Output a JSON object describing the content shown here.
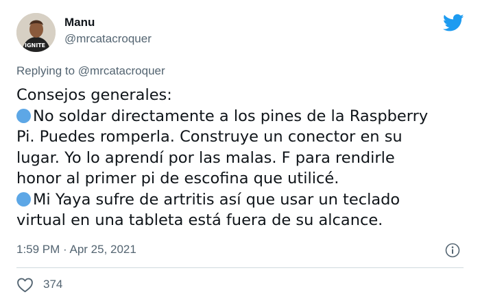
{
  "author": {
    "name": "Manu",
    "handle": "@mrcatacroquer",
    "avatar_text": "IGNITE"
  },
  "reply": {
    "prefix": "Replying to ",
    "to": "@mrcatacroquer"
  },
  "tweet": {
    "lines": [
      "Consejos generales:",
      "No soldar directamente a los pines de la Raspberry",
      "Pi. Puedes romperla. Construye un conector en su",
      "lugar. Yo lo aprendí por las malas. F para rendirle",
      "honor al primer pi de escofina que utilicé.",
      "Mi Yaya sufre de artritis así que usar un teclado",
      "virtual en una tableta está fuera de su alcance."
    ]
  },
  "meta": {
    "timestamp": "1:59 PM · Apr 25, 2021"
  },
  "engagement": {
    "likes": "374"
  },
  "icons": {
    "logo": "twitter-bird-icon",
    "bullet": "blue-circle-emoji",
    "info": "info-icon",
    "like": "heart-icon"
  },
  "colors": {
    "brand": "#1d9bf0",
    "secondary_text": "#536471",
    "bullet": "#5da7e6"
  }
}
